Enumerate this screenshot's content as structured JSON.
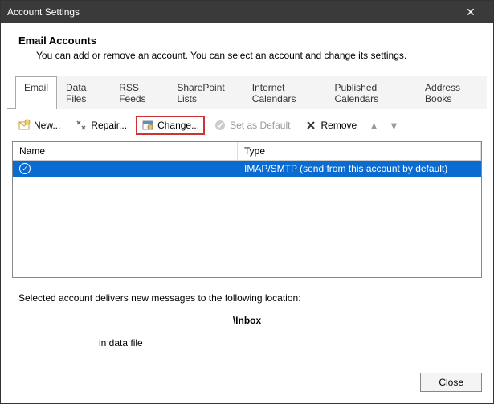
{
  "window": {
    "title": "Account Settings"
  },
  "header": {
    "title": "Email Accounts",
    "subtitle": "You can add or remove an account. You can select an account and change its settings."
  },
  "tabs": [
    "Email",
    "Data Files",
    "RSS Feeds",
    "SharePoint Lists",
    "Internet Calendars",
    "Published Calendars",
    "Address Books"
  ],
  "toolbar": {
    "new": "New...",
    "repair": "Repair...",
    "change": "Change...",
    "setdefault": "Set as Default",
    "remove": "Remove"
  },
  "table": {
    "headers": {
      "name": "Name",
      "type": "Type"
    },
    "rows": [
      {
        "name": "",
        "type": "IMAP/SMTP (send from this account by default)"
      }
    ]
  },
  "location": {
    "line1": "Selected account delivers new messages to the following location:",
    "inbox": "\\Inbox",
    "datafile": "in data file"
  },
  "footer": {
    "close": "Close"
  }
}
